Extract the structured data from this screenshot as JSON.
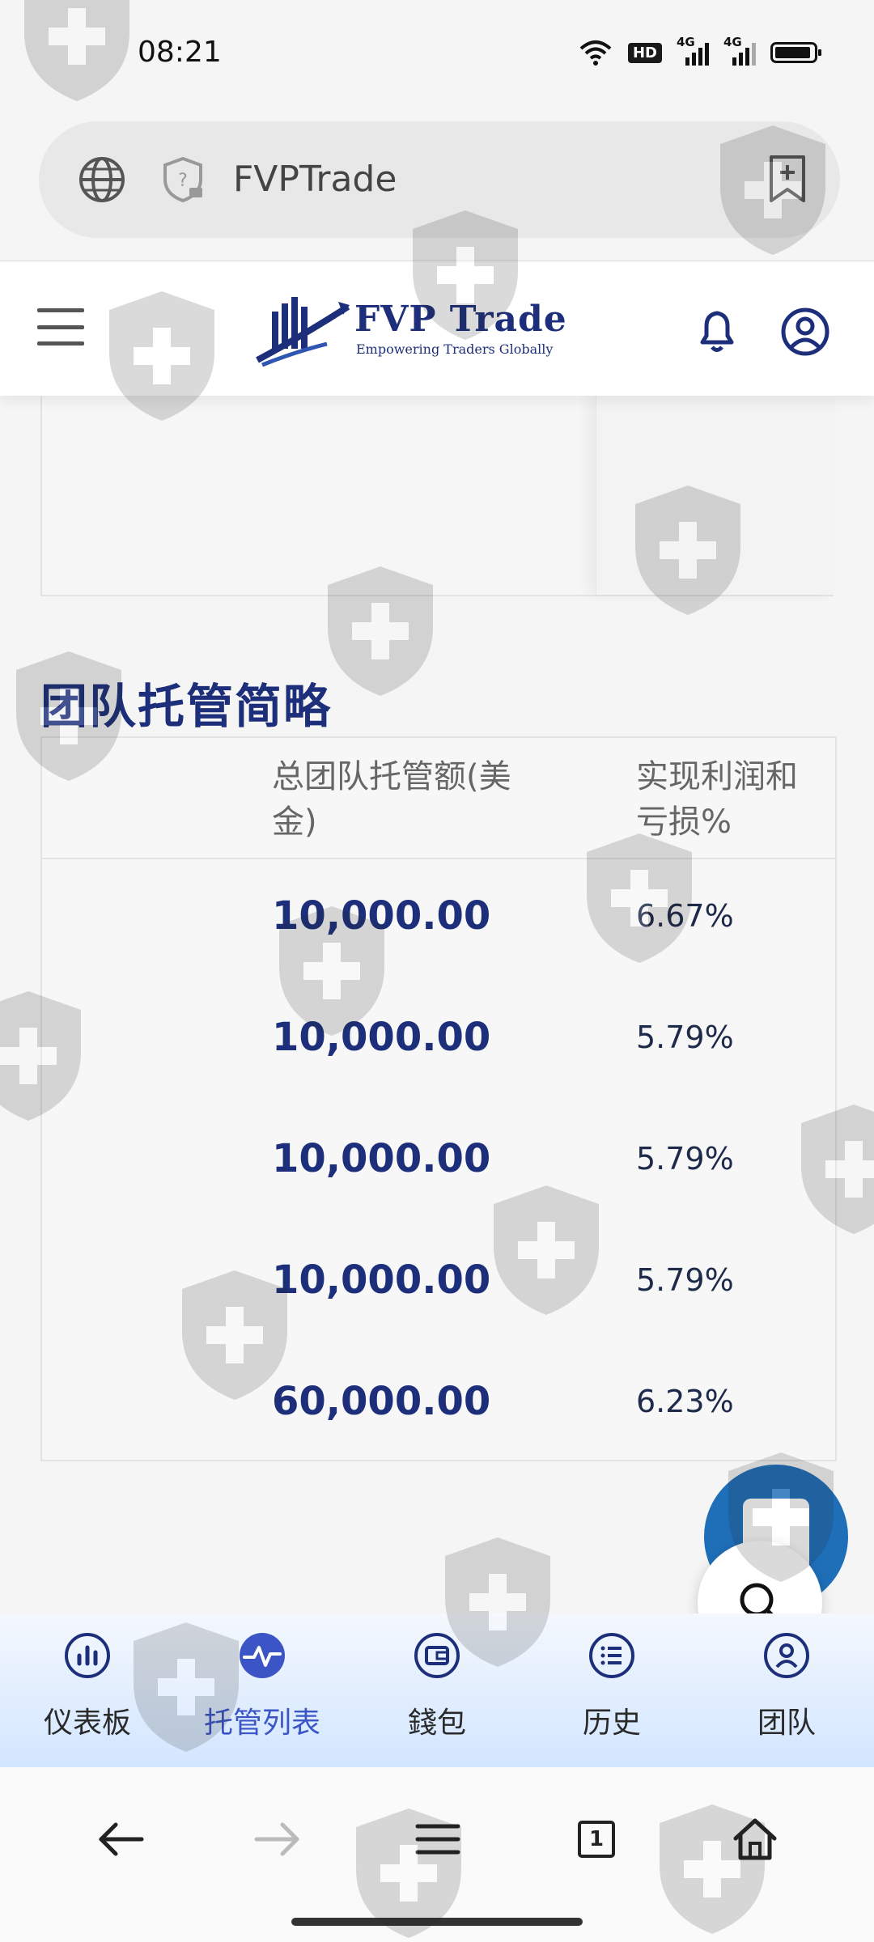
{
  "status_bar": {
    "time": "08:21",
    "hd_badge": "HD",
    "signal_1": "4G",
    "signal_2": "4G"
  },
  "address_bar": {
    "url_text": "FVPTrade",
    "icons": [
      "globe-icon",
      "security-shield-icon",
      "add-bookmark-icon"
    ]
  },
  "site_header": {
    "brand_name": "FVP Trade",
    "brand_tagline": "Empowering Traders Globally",
    "icons": [
      "menu-icon",
      "bell-icon",
      "user-icon"
    ]
  },
  "team_summary": {
    "title": "团队托管简略",
    "header_amount": "总团队托管额(美金)",
    "header_pnl": "实现利润和亏损%",
    "rows": [
      {
        "amount": "10,000.00",
        "pnl": "6.67%"
      },
      {
        "amount": "10,000.00",
        "pnl": "5.79%"
      },
      {
        "amount": "10,000.00",
        "pnl": "5.79%"
      },
      {
        "amount": "10,000.00",
        "pnl": "5.79%"
      },
      {
        "amount": "60,000.00",
        "pnl": "6.23%"
      }
    ]
  },
  "bottom_nav": {
    "items": [
      {
        "label": "仪表板",
        "icon": "chart-icon",
        "active": false
      },
      {
        "label": "托管列表",
        "icon": "pulse-icon",
        "active": true
      },
      {
        "label": "錢包",
        "icon": "wallet-icon",
        "active": false
      },
      {
        "label": "历史",
        "icon": "list-icon",
        "active": false
      },
      {
        "label": "团队",
        "icon": "team-icon",
        "active": false
      }
    ]
  },
  "browser_bar": {
    "tab_count": "1",
    "icons": [
      "back-arrow-icon",
      "forward-arrow-icon",
      "menu-icon",
      "tabs-icon",
      "home-icon"
    ]
  },
  "colors": {
    "brand_navy": "#1d2f7a",
    "active_blue": "#3b55c6",
    "fab_blue": "#1f6fb8"
  }
}
